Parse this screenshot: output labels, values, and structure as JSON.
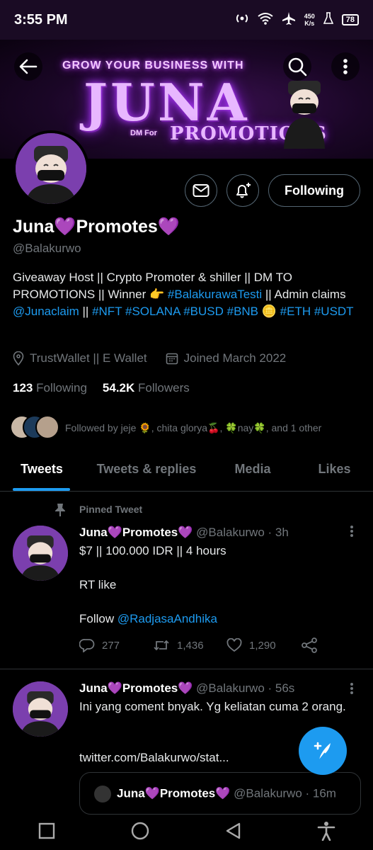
{
  "status_bar": {
    "time": "3:55 PM",
    "speed_value": "450",
    "speed_unit": "K/s",
    "battery": "78"
  },
  "banner": {
    "line1": "GROW YOUR BUSINESS WITH",
    "brand": "JUNA",
    "dm_text": "DM For",
    "promotions": "PROMOTIONS"
  },
  "profile": {
    "display_name": "Juna💜Promotes💜",
    "handle": "@Balakurwo",
    "bio": {
      "text1": "Giveaway Host || Crypto Promoter & shiller || DM TO PROMOTIONS || Winner 👉 ",
      "hashtag1": "#BalakurawaTesti",
      "text2": " || Admin claims ",
      "mention1": "@Junaclaim",
      "text3": " || ",
      "tags_line": "#NFT #SOLANA #BUSD #BNB",
      "text4": " 🪙 ",
      "tags_line2": "#ETH #USDT"
    },
    "location": "TrustWallet || E Wallet",
    "joined": "Joined March 2022",
    "following_count": "123",
    "following_label": "Following",
    "followers_count": "54.2K",
    "followers_label": "Followers",
    "followed_by": "Followed by jeje 🌻, chita glorya🍒, 🍀nay🍀, and 1 other",
    "following_button": "Following"
  },
  "tabs": [
    {
      "label": "Tweets"
    },
    {
      "label": "Tweets & replies"
    },
    {
      "label": "Media"
    },
    {
      "label": "Likes"
    }
  ],
  "tweets": [
    {
      "pinned_label": "Pinned Tweet",
      "name": "Juna💜Promotes💜",
      "handle_time": "@Balakurwo · 3h",
      "line1": "$7 || 100.000 IDR || 4 hours",
      "line2": "RT like",
      "line3_text": "Follow ",
      "line3_mention": "@RadjasaAndhika",
      "replies": "277",
      "retweets": "1,436",
      "likes": "1,290"
    },
    {
      "name": "Juna💜Promotes💜",
      "handle_time": "@Balakurwo · 56s",
      "text": "Ini yang coment bnyak. Yg keliatan cuma 2 orang.",
      "link": "twitter.com/Balakurwo/stat...",
      "quote_name": "Juna💜Promotes💜",
      "quote_handle_time": "@Balakurwo · 16m"
    }
  ],
  "colors": {
    "accent": "#1d9bf0",
    "background": "#000000",
    "secondary_text": "#71767b",
    "banner_purple": "#b23dff"
  }
}
